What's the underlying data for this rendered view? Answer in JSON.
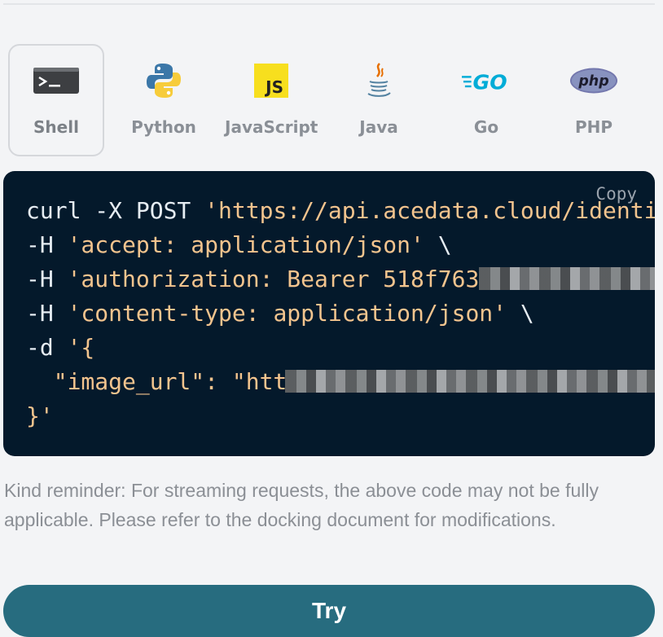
{
  "languages": [
    {
      "label": "Shell",
      "icon": "terminal-icon",
      "selected": true
    },
    {
      "label": "Python",
      "icon": "python-icon",
      "selected": false
    },
    {
      "label": "JavaScript",
      "icon": "javascript-icon",
      "selected": false
    },
    {
      "label": "Java",
      "icon": "java-icon",
      "selected": false
    },
    {
      "label": "Go",
      "icon": "go-icon",
      "selected": false
    },
    {
      "label": "PHP",
      "icon": "php-icon",
      "selected": false
    }
  ],
  "icon_text": {
    "javascript": "JS",
    "go": "GO",
    "php": "php"
  },
  "code": {
    "copy_label": "Copy",
    "line1_cmd": "curl -X POST ",
    "line1_str": "'https://api.acedata.cloud/identi",
    "line2_flag": "-H ",
    "line2_str": "'accept: application/json'",
    "line2_end": " \\",
    "line3_flag": "-H ",
    "line3_str": "'authorization: Bearer 518f763",
    "line4_flag": "-H ",
    "line4_str": "'content-type: application/json'",
    "line4_end": " \\",
    "line5_flag": "-d ",
    "line5_str": "'{",
    "line6_str": "  \"image_url\": \"htt",
    "line7_str": "}'"
  },
  "reminder": "Kind reminder: For streaming requests, the above code may not be fully applicable. Please refer to the docking document for modifications.",
  "try_label": "Try",
  "colors": {
    "background": "#f3f4f6",
    "code_bg": "#04192b",
    "code_string": "#f3c48e",
    "button": "#276c7f",
    "js_yellow": "#f7df1e",
    "go_cyan": "#00acd7",
    "php_purple": "#7377ad"
  }
}
